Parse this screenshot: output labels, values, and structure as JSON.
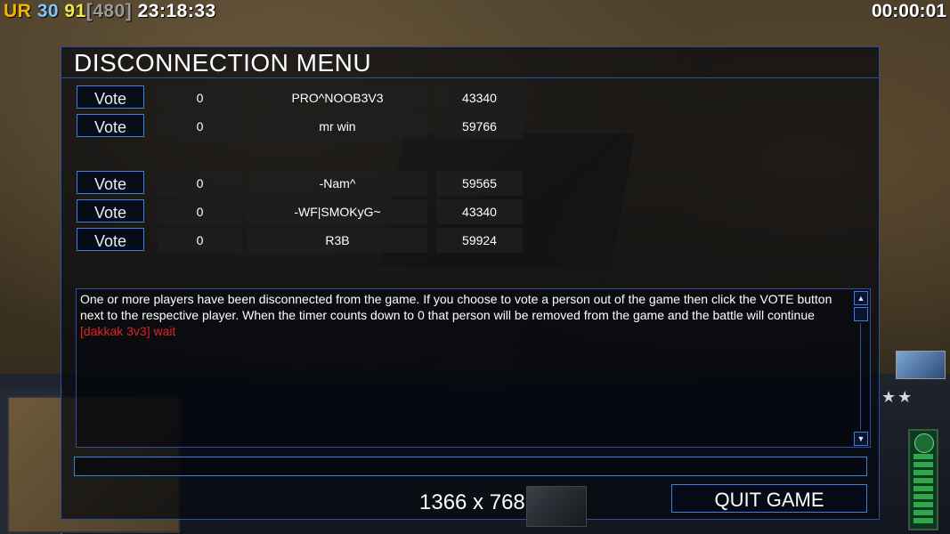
{
  "hud": {
    "ur": "UR",
    "n30": "30",
    "n91": "91",
    "n480": "[480]",
    "clock": "23:18:33",
    "timer": "00:00:01"
  },
  "dialog": {
    "title": "DISCONNECTION MENU",
    "vote_label": "Vote",
    "team1": [
      {
        "count": "0",
        "name": "PRO^NOOB3V3",
        "id": "43340"
      },
      {
        "count": "0",
        "name": "mr win",
        "id": "59766"
      }
    ],
    "team2": [
      {
        "count": "0",
        "name": "-Nam^",
        "id": "59565"
      },
      {
        "count": "0",
        "name": "-WF|SMOKyG~",
        "id": "43340"
      },
      {
        "count": "0",
        "name": "R3B",
        "id": "59924"
      }
    ],
    "message": "One or more players have been disconnected from the game. If you choose to vote a person out of the game then click the VOTE button next to the respective player. When the timer counts down to 0 that person will be removed from the game and the battle will continue",
    "chat_line": "[dakkak 3v3] wait",
    "chat_input_value": "",
    "resolution": "1366 x 768",
    "quit_label": "QUIT GAME"
  },
  "colors": {
    "accent_blue": "#3a7fe0",
    "chat_red": "#e02424"
  }
}
